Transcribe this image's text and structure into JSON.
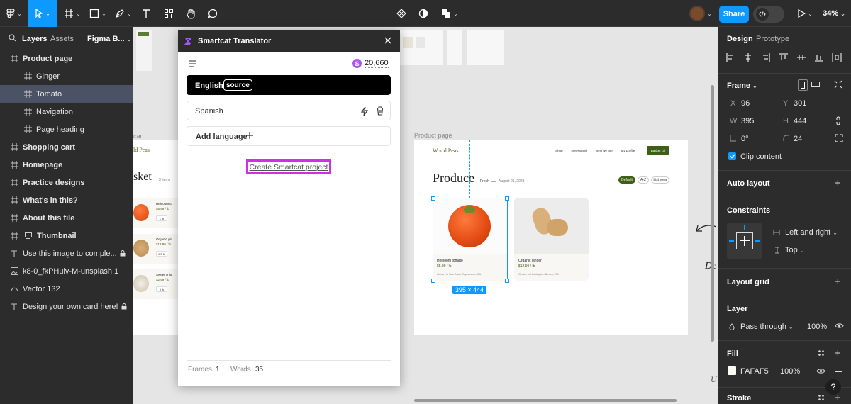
{
  "toolbar": {
    "share_label": "Share",
    "zoom_label": "34%",
    "colors": {
      "accent": "#0d99ff",
      "bg": "#2c2c2c"
    }
  },
  "left_panel": {
    "tabs": {
      "layers": "Layers",
      "assets": "Assets",
      "page": "Figma B..."
    },
    "layers": [
      {
        "label": "Product page",
        "icon": "frame-icon",
        "bold": true
      },
      {
        "label": "Ginger",
        "icon": "frame-icon"
      },
      {
        "label": "Tomato",
        "icon": "frame-icon",
        "selected": true
      },
      {
        "label": "Navigation",
        "icon": "frame-icon"
      },
      {
        "label": "Page heading",
        "icon": "frame-icon"
      },
      {
        "label": "Shopping cart",
        "icon": "frame-icon",
        "bold": true
      },
      {
        "label": "Homepage",
        "icon": "frame-icon",
        "bold": true
      },
      {
        "label": "Practice designs",
        "icon": "frame-icon",
        "bold": true
      },
      {
        "label": "What's in this?",
        "icon": "frame-icon",
        "bold": true
      },
      {
        "label": "About this file",
        "icon": "frame-icon",
        "bold": true
      },
      {
        "label": "Thumbnail",
        "icon": "frame-icon",
        "bold": true
      },
      {
        "label": "Use this image to comple...",
        "icon": "text-icon",
        "locked": true
      },
      {
        "label": "k8-0_fkPHulv-M-unsplash 1",
        "icon": "image-icon"
      },
      {
        "label": "Vector 132",
        "icon": "vector-icon"
      },
      {
        "label": "Design your own card here!",
        "icon": "text-icon",
        "locked": true
      }
    ]
  },
  "plugin": {
    "title": "Smartcat Translator",
    "credits": "20,660",
    "source_language": "English",
    "source_badge": "source",
    "target_language": "Spanish",
    "add_language": "Add language",
    "create_project": "Create Smartcat project",
    "frames_label": "Frames",
    "frames_count": "1",
    "words_label": "Words",
    "words_count": "35"
  },
  "canvas": {
    "left_frame_label": "cart",
    "left_frame": {
      "brand": "ld Peas",
      "heading": "sket",
      "count": "3 items",
      "items": [
        {
          "name": "Heirloom to",
          "price": "$5.99 / lb",
          "qty": "1 lb"
        },
        {
          "name": "Organic gin",
          "price": "$12.99 / lb",
          "qty": "0.5 lb"
        },
        {
          "name": "Sweet onio",
          "price": "$2.99 / lb",
          "qty": "5 lb"
        }
      ]
    },
    "product_frame_label": "Product page",
    "product_frame": {
      "brand": "World Peas",
      "nav": [
        "Shop",
        "Newsstand",
        "Who we are",
        "My profile"
      ],
      "basket_button": "Basket (3)",
      "heading": "Produce",
      "tag": "Fresh",
      "date": "August 21, 2023",
      "filters": [
        "Default",
        "A-Z",
        "List view"
      ],
      "cards": [
        {
          "name": "Heirloom tomato",
          "price": "$5.99 / lb",
          "origin": "Grown in San Juan Capistrano, CA"
        },
        {
          "name": "Organic ginger",
          "price": "$12.99 / lb",
          "origin": "Grown in Huntington Beach, CA"
        }
      ],
      "size_badge": "395 × 444"
    },
    "side_text_1": "De",
    "side_text_2": "U"
  },
  "right_panel": {
    "tabs": {
      "design": "Design",
      "prototype": "Prototype"
    },
    "frame_label": "Frame",
    "x_label": "X",
    "x": "96",
    "y_label": "Y",
    "y": "301",
    "w_label": "W",
    "w": "395",
    "h_label": "H",
    "h": "444",
    "rotation": "0°",
    "radius": "24",
    "clip_content": "Clip content",
    "auto_layout": "Auto layout",
    "constraints": "Constraints",
    "constraint_h": "Left and right",
    "constraint_v": "Top",
    "layout_grid": "Layout grid",
    "layer": "Layer",
    "blend_mode": "Pass through",
    "layer_opacity": "100%",
    "fill": "Fill",
    "fill_hex": "FAFAF5",
    "fill_opacity": "100%",
    "stroke": "Stroke",
    "help": "?"
  }
}
